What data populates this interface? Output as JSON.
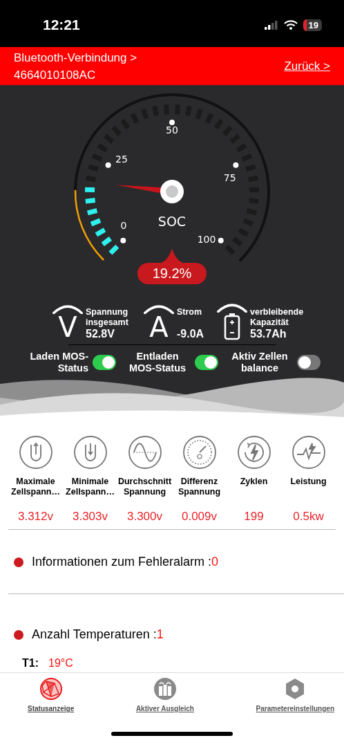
{
  "status_bar": {
    "time": "12:21",
    "battery": "19"
  },
  "header": {
    "title": "Bluetooth-Verbindung >",
    "device": "4664010108AC",
    "back_link": "Zurück >"
  },
  "gauge": {
    "tick_labels": [
      "0",
      "25",
      "50",
      "75",
      "100"
    ],
    "label": "SOC",
    "reading": "19.2%"
  },
  "readings": [
    {
      "kind": "voltage",
      "symbol": "V",
      "label": "Spannung insgesamt",
      "value": "52.8V"
    },
    {
      "kind": "current",
      "symbol": "A",
      "label": "Strom",
      "value": "-9.0A"
    },
    {
      "kind": "capacity",
      "label": "verbleibende Kapazität",
      "value": "53.7Ah"
    }
  ],
  "toggles": [
    {
      "label": "Laden MOS-Status",
      "on": true
    },
    {
      "label": "Entladen MOS-Status",
      "on": true
    },
    {
      "label": "Aktiv Zellen balance",
      "on": false
    }
  ],
  "metrics": [
    {
      "label": "Maximale Zellspann…",
      "value": "3.312v"
    },
    {
      "label": "Minimale Zellspann…",
      "value": "3.303v"
    },
    {
      "label": "Durchschnitt Spannung",
      "value": "3.300v"
    },
    {
      "label": "Differenz Spannung",
      "value": "0.009v"
    },
    {
      "label": "Zyklen",
      "value": "199"
    },
    {
      "label": "Leistung",
      "value": "0.5kw"
    }
  ],
  "info_rows": [
    {
      "label": "Informationen zum Fehleralarm :",
      "count": "0"
    },
    {
      "label": "Anzahl Temperaturen :",
      "count": "1"
    }
  ],
  "temperatures": [
    {
      "name": "T1:",
      "value": "19°C"
    }
  ],
  "bottom_nav": [
    {
      "label": "Statusanzeige",
      "selected": true
    },
    {
      "label": "Aktiver Ausgleich",
      "selected": false
    },
    {
      "label": "Parametereinstellungen",
      "selected": false
    }
  ]
}
